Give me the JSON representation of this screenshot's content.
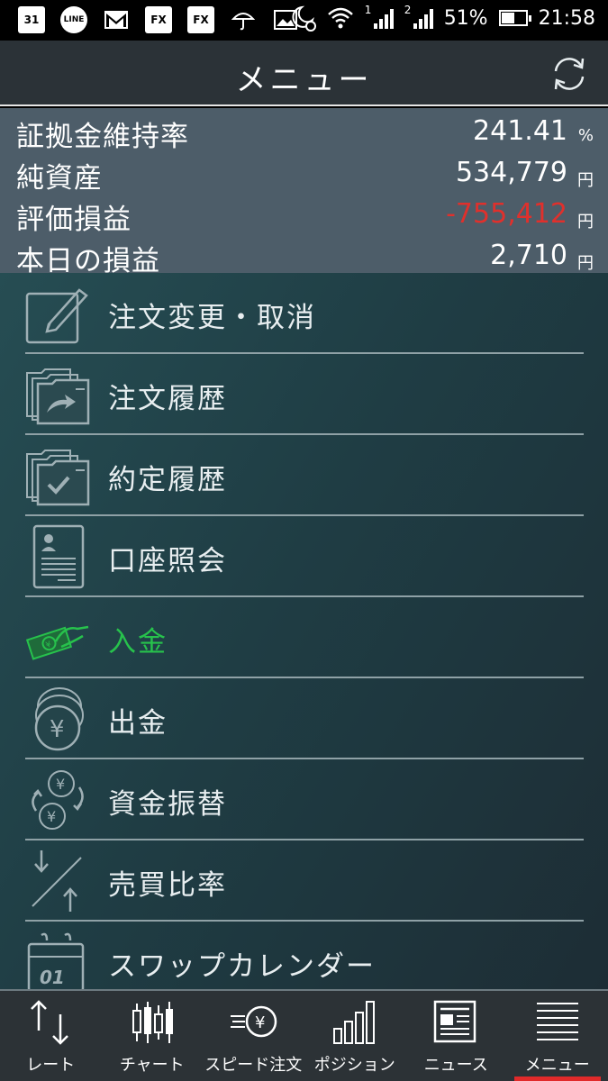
{
  "status_bar": {
    "left_icons": [
      {
        "name": "calendar-icon",
        "text": "31"
      },
      {
        "name": "line-app-icon",
        "text": "LINE"
      },
      {
        "name": "gmail-icon",
        "text": "M"
      },
      {
        "name": "fx-app-icon",
        "text": "FX"
      },
      {
        "name": "fx-app-icon-2",
        "text": "FX"
      },
      {
        "name": "umbrella-icon",
        "text": ""
      },
      {
        "name": "image-icon",
        "text": ""
      }
    ],
    "battery": "51%",
    "time": "21:58",
    "sim1": "1",
    "sim2": "2"
  },
  "header": {
    "title": "メニュー"
  },
  "summary": [
    {
      "label": "証拠金維持率",
      "value": "241.41",
      "unit": "%",
      "negative": false
    },
    {
      "label": "純資産",
      "value": "534,779",
      "unit": "円",
      "negative": false
    },
    {
      "label": "評価損益",
      "value": "-755,412",
      "unit": "円",
      "negative": true
    },
    {
      "label": "本日の損益",
      "value": "2,710",
      "unit": "円",
      "negative": false
    }
  ],
  "menu": [
    {
      "label": "注文変更・取消",
      "icon": "edit-document-icon",
      "active": false
    },
    {
      "label": "注文履歴",
      "icon": "order-history-icon",
      "active": false
    },
    {
      "label": "約定履歴",
      "icon": "execution-history-icon",
      "active": false
    },
    {
      "label": "口座照会",
      "icon": "account-card-icon",
      "active": false
    },
    {
      "label": "入金",
      "icon": "deposit-icon",
      "active": true
    },
    {
      "label": "出金",
      "icon": "withdraw-coins-icon",
      "active": false
    },
    {
      "label": "資金振替",
      "icon": "fund-transfer-icon",
      "active": false
    },
    {
      "label": "売買比率",
      "icon": "trade-ratio-icon",
      "active": false
    },
    {
      "label": "スワップカレンダー",
      "icon": "swap-calendar-icon",
      "active": false
    }
  ],
  "calendar_icon_text": "01",
  "nav": [
    {
      "label": "レート",
      "icon": "rate-arrows-icon",
      "active": false
    },
    {
      "label": "チャート",
      "icon": "candlestick-chart-icon",
      "active": false
    },
    {
      "label": "スピード注文",
      "icon": "speed-order-icon",
      "active": false
    },
    {
      "label": "ポジション",
      "icon": "position-bars-icon",
      "active": false
    },
    {
      "label": "ニュース",
      "icon": "news-icon",
      "active": false
    },
    {
      "label": "メニュー",
      "icon": "menu-lines-icon",
      "active": true
    }
  ],
  "colors": {
    "negative": "#e0302c",
    "active_menu": "#27c24c",
    "active_tab_underline": "#e12a2a"
  }
}
